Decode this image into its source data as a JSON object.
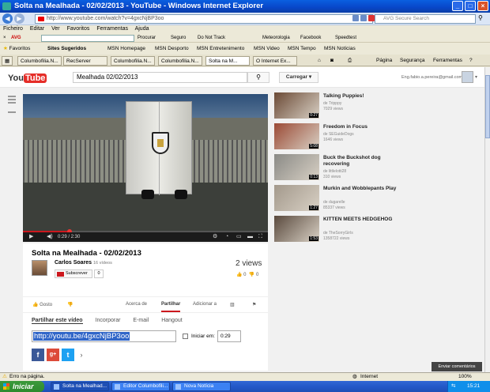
{
  "window": {
    "title": "Solta na Mealhada - 02/02/2013 - YouTube - Windows Internet Explorer",
    "controls": [
      "_",
      "□",
      "×"
    ]
  },
  "addressbar": {
    "url": "http://www.youtube.com/watch?v=4gxcNjBP3oo",
    "search_placeholder": "AVG Secure Search"
  },
  "menu": [
    "Ficheiro",
    "Editar",
    "Ver",
    "Favoritos",
    "Ferramentas",
    "Ajuda"
  ],
  "avg_toolbar": {
    "brand": "AVG",
    "items": [
      "Procurar",
      "Seguro",
      "Do Not Track",
      "Meteorologia",
      "Facebook",
      "Speedtest"
    ]
  },
  "favorites_bar": {
    "label": "Favoritos",
    "items": [
      "Sites Sugeridos",
      "MSN Homepage",
      "MSN Desporto",
      "MSN Entretenimento",
      "MSN Video",
      "MSN Tempo",
      "MSN Notícias"
    ]
  },
  "tabs": [
    "Columbofilia.N...",
    "RecServer",
    "Columbofilia.N...",
    "Columbofilia.N...",
    "Solta na M...",
    "O Internet Ex..."
  ],
  "ie_commands": [
    "Página",
    "Segurança",
    "Ferramentas"
  ],
  "youtube": {
    "logo_you": "You",
    "logo_tube": "Tube",
    "search_value": "Mealhada 02/02/2013",
    "upload_label": "Carregar",
    "account_email": "Eng.fabio.a.pereira@gmail.com"
  },
  "player": {
    "time": "0:29 / 2:30",
    "progress": 0.19
  },
  "video": {
    "title": "Solta na Mealhada - 02/02/2013",
    "channel": "Carlos Soares",
    "channel_videos": "16 vídeos",
    "subscribe": "Subscrever",
    "subscribers": "0",
    "views": "2 views",
    "likes": "0",
    "dislikes": "0"
  },
  "actions": {
    "like": "Gosto",
    "about": "Acerca de",
    "share": "Partilhar",
    "add_to": "Adicionar a"
  },
  "share": {
    "tabs": [
      "Partilhar este vídeo",
      "Incorporar",
      "E-mail",
      "Hangout"
    ],
    "url": "http://youtu.be/4gxcNjBP3oo",
    "start_label": "Iniciar em:",
    "start_value": "0:29",
    "socials": [
      "f",
      "g+",
      "t",
      "›"
    ]
  },
  "related": [
    {
      "title": "Talking Puppies!",
      "by": "de Tripppy",
      "views": "7029 views",
      "duration": "0:27",
      "color": "#6b4a36"
    },
    {
      "title": "Freedom in Focus",
      "by": "de SEGuideDogs",
      "views": "1646 views",
      "duration": "5:08",
      "color": "#9b4a35"
    },
    {
      "title": "Buck the Buckshot dog recovering",
      "by": "de littlelotti28",
      "views": "310 views",
      "duration": "0:13",
      "color": "#8a8a86"
    },
    {
      "title": "Murkin and Wobblepants Play",
      "by": "de dugarelle",
      "views": "85337 views",
      "duration": "1:27",
      "color": "#a3998c"
    },
    {
      "title": "KITTEN MEETS HEDGEHOG",
      "by": "de TheSorryGirls",
      "views": "1358722 views",
      "duration": "1:53",
      "color": "#5a4a3e"
    }
  ],
  "feedback_label": "Enviar comentários",
  "statusbar": {
    "text": "Erro na página.",
    "zone": "Internet",
    "zoom": "100%"
  },
  "taskbar": {
    "start": "Iniciar",
    "items": [
      "Solta na Mealhad...",
      "Editor Columbofili...",
      "Nova Notícia"
    ],
    "time": "15:21"
  }
}
